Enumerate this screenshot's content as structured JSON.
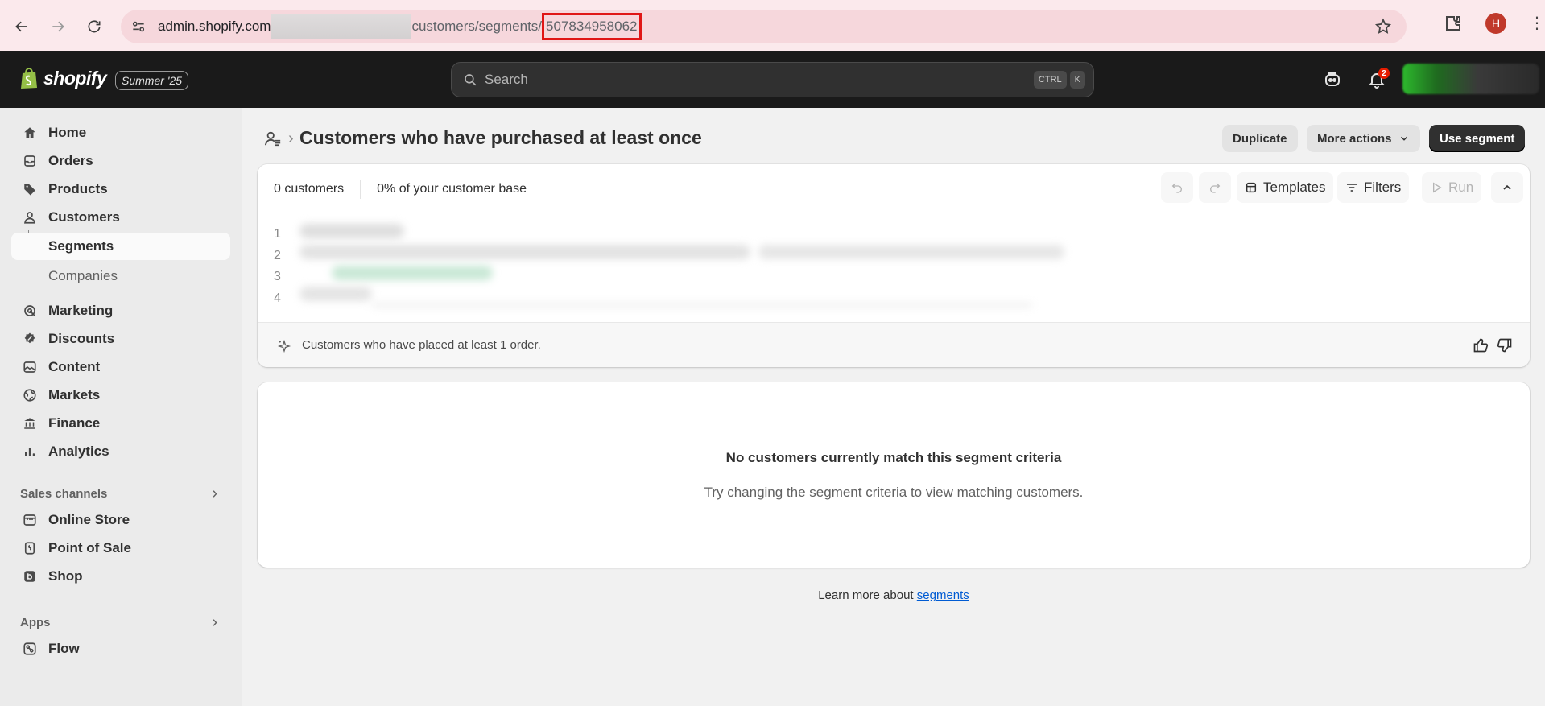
{
  "browser": {
    "url_host": "admin.shopify.com",
    "url_path": "customers/segments/",
    "url_id": "507834958062",
    "profile_initial": "H"
  },
  "topbar": {
    "logo_text": "shopify",
    "edition_badge": "Summer '25",
    "search_placeholder": "Search",
    "shortcut_ctrl": "CTRL",
    "shortcut_key": "K",
    "notification_count": "2"
  },
  "sidebar": {
    "items": [
      {
        "label": "Home",
        "icon": "home-icon"
      },
      {
        "label": "Orders",
        "icon": "orders-icon"
      },
      {
        "label": "Products",
        "icon": "tag-icon"
      },
      {
        "label": "Customers",
        "icon": "person-icon"
      }
    ],
    "sub_items": [
      "Segments",
      "Companies"
    ],
    "items2": [
      {
        "label": "Marketing",
        "icon": "target-icon"
      },
      {
        "label": "Discounts",
        "icon": "discount-icon"
      },
      {
        "label": "Content",
        "icon": "image-icon"
      },
      {
        "label": "Markets",
        "icon": "globe-icon"
      },
      {
        "label": "Finance",
        "icon": "bank-icon"
      },
      {
        "label": "Analytics",
        "icon": "chart-icon"
      }
    ],
    "sales_channels_label": "Sales channels",
    "channels": [
      {
        "label": "Online Store",
        "icon": "store-icon"
      },
      {
        "label": "Point of Sale",
        "icon": "pos-icon"
      },
      {
        "label": "Shop",
        "icon": "shop-icon"
      }
    ],
    "apps_label": "Apps",
    "apps": [
      {
        "label": "Flow",
        "icon": "flow-icon"
      }
    ]
  },
  "page": {
    "title": "Customers who have purchased at least once",
    "duplicate_label": "Duplicate",
    "more_actions_label": "More actions",
    "use_segment_label": "Use segment"
  },
  "editor": {
    "customer_count": "0 customers",
    "customer_base": "0% of your customer base",
    "templates_label": "Templates",
    "filters_label": "Filters",
    "run_label": "Run",
    "line_numbers": [
      "1",
      "2",
      "3",
      "4"
    ],
    "ai_summary": "Customers who have placed at least 1 order."
  },
  "empty_state": {
    "title": "No customers currently match this segment criteria",
    "subtitle": "Try changing the segment criteria to view matching customers."
  },
  "footer": {
    "learn_prefix": "Learn more about ",
    "learn_link": "segments"
  }
}
